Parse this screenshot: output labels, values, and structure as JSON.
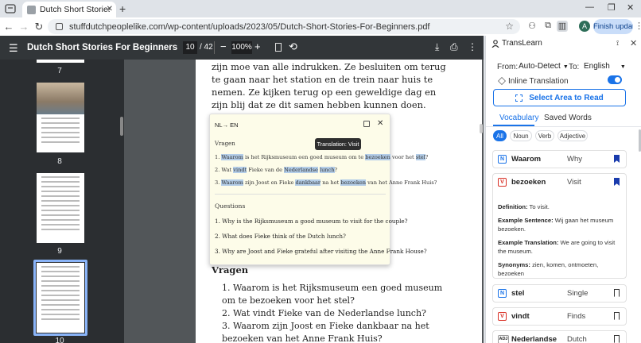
{
  "browser": {
    "tab_title": "Dutch Short Stories For Beginners",
    "url": "stuffdutchpeoplelike.com/wp-content/uploads/2023/05/Dutch-Short-Stories-For-Beginners.pdf",
    "profile_initial": "A",
    "update_button": "Finish update"
  },
  "pdf": {
    "title": "Dutch Short Stories For Beginners",
    "current_page": "10",
    "total_pages": "/ 42",
    "zoom": "100%",
    "thumbnail_numbers": [
      "7",
      "8",
      "9",
      "10"
    ],
    "body_lines": [
      "zijn moe van alle indrukken. Ze besluiten om terug",
      "te gaan naar het station en de trein naar huis te",
      "nemen. Ze kijken terug op een geweldige dag en",
      "zijn blij dat ze dit samen hebben kunnen doen."
    ],
    "section_heading": "Vragen",
    "questions": [
      "1. Waarom is het Rijksmuseum een goed museum",
      "om te bezoeken voor het stel?",
      "2. Wat vindt Fieke van de Nederlandse lunch?",
      "3. Waarom zijn Joost en Fieke dankbaar na het",
      "bezoeken van het Anne Frank Huis?"
    ]
  },
  "popup": {
    "lang": "NL→ EN",
    "source_heading": "Vragen",
    "source_lines": [
      [
        "1. ",
        "Waarom",
        " is het Rijksmuseum een goed museum om te ",
        "bezoeken",
        " voor het ",
        "stel",
        "?"
      ],
      [
        "2. Wat ",
        "vindt",
        " Fieke van de ",
        "Nederlandse",
        " ",
        "lunch",
        "?"
      ],
      [
        "3. ",
        "Waarom",
        " zijn Joost en Fieke ",
        "dankbaar",
        " na het ",
        "bezoeken",
        " van het Anne Frank Huis?"
      ]
    ],
    "target_heading": "Questions",
    "target_lines": [
      "1. Why is the Rijksmuseum a good museum to visit for the couple?",
      "2. What does Fieke think of the Dutch lunch?",
      "3. Why are Joost and Fieke grateful after visiting the Anne Frank House?"
    ],
    "tooltip": "Translation: Visit"
  },
  "panel": {
    "title": "TransLearn",
    "from_label": "From:",
    "from_value": "Auto-Detect",
    "to_label": "To:",
    "to_value": "English",
    "inline_label": "Inline Translation",
    "select_area": "Select Area to Read",
    "tabs": [
      "Vocabulary",
      "Saved Words"
    ],
    "filters": [
      "All",
      "Noun",
      "Verb",
      "Adjective"
    ],
    "cards": [
      {
        "pos": "N",
        "word": "Waarom",
        "translation": "Why",
        "saved": true
      },
      {
        "pos": "V",
        "word": "bezoeken",
        "translation": "Visit",
        "saved": true
      },
      {
        "pos": "N",
        "word": "stel",
        "translation": "Single",
        "saved": false
      },
      {
        "pos": "V",
        "word": "vindt",
        "translation": "Finds",
        "saved": false
      },
      {
        "pos": "ADJ",
        "word": "Nederlandse",
        "translation": "Dutch",
        "saved": false
      }
    ],
    "detail": {
      "definition_label": "Definition:",
      "definition": "To visit.",
      "example_label": "Example Sentence:",
      "example": "Wij gaan het museum bezoeken.",
      "translation_label": "Example Translation:",
      "translation": "We are going to visit the museum.",
      "synonyms_label": "Synonyms:",
      "synonyms": "zien, komen, ontmoeten, bezoeken"
    }
  },
  "colors": {
    "accent": "#1a73e8",
    "pdf_toolbar": "#323639",
    "highlight": "#b3cde8",
    "popup_bg": "#fdfce9"
  }
}
